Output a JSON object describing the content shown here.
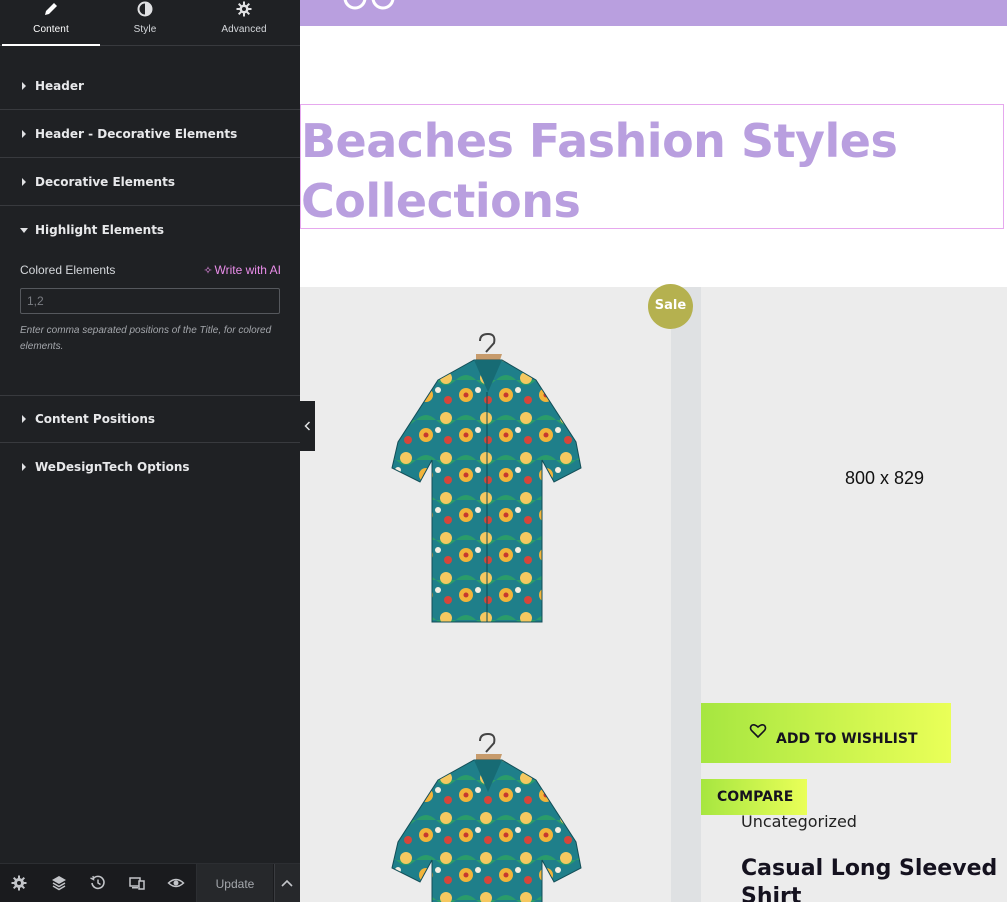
{
  "editor": {
    "tabs": [
      {
        "label": "Content",
        "icon": "pencil-icon",
        "active": true
      },
      {
        "label": "Style",
        "icon": "half-circle-icon",
        "active": false
      },
      {
        "label": "Advanced",
        "icon": "gear-icon",
        "active": false
      }
    ],
    "sections": [
      {
        "label": "Header",
        "expanded": false
      },
      {
        "label": "Header - Decorative Elements",
        "expanded": false
      },
      {
        "label": "Decorative Elements",
        "expanded": false
      },
      {
        "label": "Highlight Elements",
        "expanded": true
      },
      {
        "label": "Content Positions",
        "expanded": false
      },
      {
        "label": "WeDesignTech Options",
        "expanded": false
      }
    ],
    "highlight": {
      "field_label": "Colored Elements",
      "ai_button": "Write with AI",
      "input_value": "",
      "input_placeholder": "1,2",
      "help_text": "Enter comma separated positions of the Title, for colored elements."
    },
    "footer": {
      "icons": [
        "settings-icon",
        "layers-icon",
        "history-icon",
        "responsive-icon",
        "preview-eye-icon"
      ],
      "update_label": "Update"
    }
  },
  "preview": {
    "heading": "Beaches Fashion Styles Collections",
    "sale_badge": "Sale",
    "image_placeholder": "800 x 829",
    "wishlist_label": "ADD TO WISHLIST",
    "compare_label": "COMPARE",
    "category": "Uncategorized",
    "product_title": "Casual Long Sleeved Shirt"
  },
  "colors": {
    "accent_purple": "#b99fdf",
    "panel_bg": "#1f2124",
    "ai_pink": "#e98de9",
    "button_green": "#a6e640",
    "button_yellow": "#eaff58",
    "sale_olive": "#b5b14f"
  }
}
